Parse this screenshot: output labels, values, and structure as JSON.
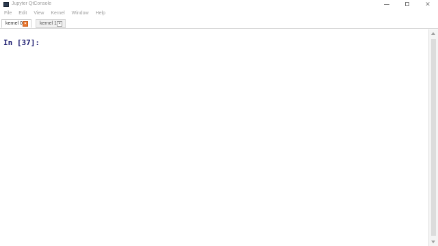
{
  "window": {
    "title": "Jupyter QtConsole",
    "controls": {
      "minimize": "—",
      "maximize": "☐",
      "close": "✕"
    }
  },
  "menu": {
    "items": [
      "File",
      "Edit",
      "View",
      "Kernel",
      "Window",
      "Help"
    ]
  },
  "tabs": [
    {
      "label": "kernel 0",
      "active": true,
      "close": "×"
    },
    {
      "label": "kernel 1",
      "active": false,
      "close": "×"
    }
  ],
  "console": {
    "prompt": "In [37]:"
  },
  "colors": {
    "prompt": "#1a1a6e",
    "active_tab_close": "#e8742c"
  },
  "icons": {
    "app": "terminal-icon",
    "tab_close": "close-icon"
  }
}
